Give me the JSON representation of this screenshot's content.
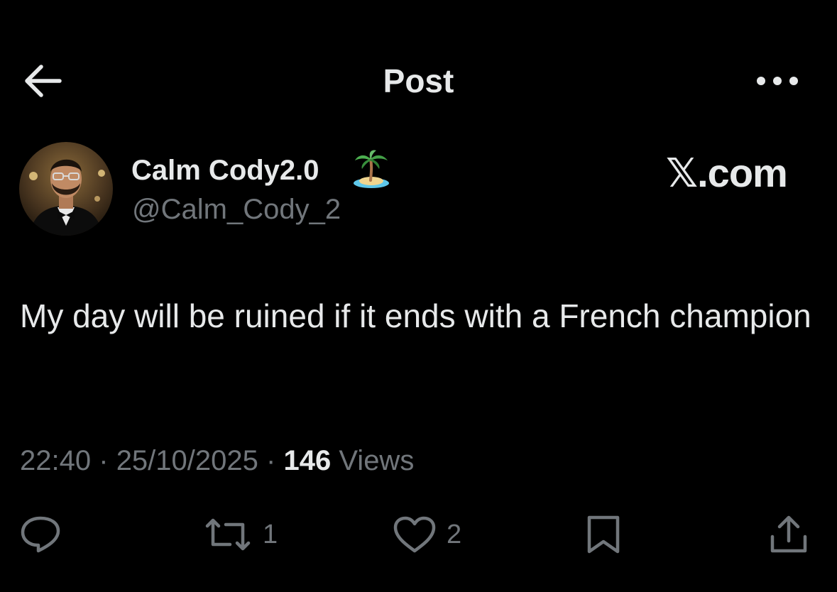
{
  "header": {
    "title": "Post"
  },
  "author": {
    "display_name": "Calm Cody2.0",
    "handle": "@Calm_Cody_2",
    "name_emoji": "desert-island-icon"
  },
  "watermark": "𝕏.com",
  "post": {
    "text": "My day will be ruined if it ends with a French champion",
    "time": "22:40",
    "date": "25/10/2025",
    "separator": "·",
    "views_count": "146",
    "views_label": "Views"
  },
  "actions": {
    "reply_icon": "reply-icon",
    "repost_icon": "repost-icon",
    "repost_count": "1",
    "like_icon": "heart-icon",
    "like_count": "2",
    "bookmark_icon": "bookmark-icon",
    "share_icon": "share-icon"
  },
  "colors": {
    "background": "#000000",
    "primary_text": "#e7e9ea",
    "secondary_text": "#71767b"
  }
}
